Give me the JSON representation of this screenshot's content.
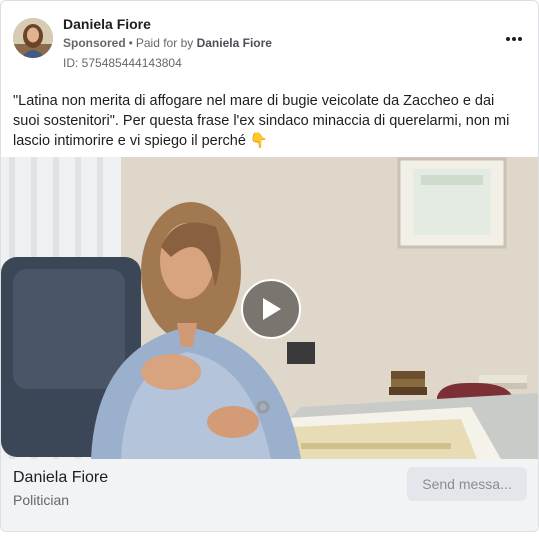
{
  "ad": {
    "page_name": "Daniela Fiore",
    "sponsored_label": "Sponsored",
    "separator": "•",
    "paid_for_prefix": "Paid for by",
    "paid_for_name": "Daniela Fiore",
    "library_id": "ID: 575485444143804",
    "body": "\"Latina non merita di affogare nel mare di bugie veicolate da Zaccheo e dai suoi sostenitori\". Per questa frase l'ex sindaco minaccia di querelarmi, non mi lascio intimorire e vi spiego il perché 👇"
  },
  "footer": {
    "title": "Daniela Fiore",
    "subtitle": "Politician",
    "cta_label": "Send messa..."
  },
  "icons": {
    "more": "more-options-icon",
    "play": "play-icon"
  },
  "colors": {
    "text_primary": "#1c1e21",
    "text_secondary": "#65676b",
    "footer_bg": "#f2f3f5",
    "cta_bg": "#e4e6eb"
  }
}
